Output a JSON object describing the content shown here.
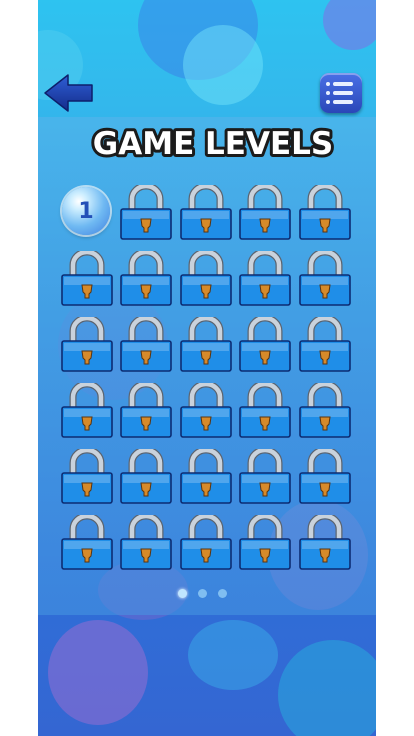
{
  "title": "GAME LEVELS",
  "levels_per_page": 30,
  "unlocked_levels": [
    1
  ],
  "level_1": "1",
  "pages": {
    "total": 3,
    "current": 1
  },
  "icons": {
    "back": "back-arrow-icon",
    "menu": "list-menu-icon",
    "locked_level": "padlock-icon"
  },
  "colors": {
    "lock_body": "#1f8ee8",
    "lock_shackle": "#c9d2dc",
    "keyhole": "#d68a2a",
    "title_text": "#ffffff",
    "title_outline": "#1b1b1b"
  }
}
